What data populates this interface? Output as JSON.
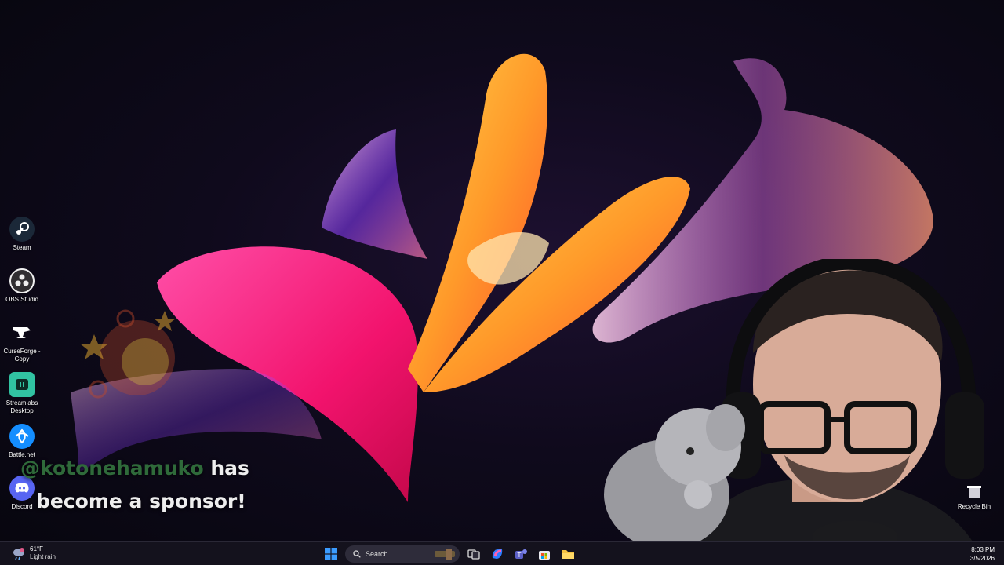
{
  "desktop": {
    "icons": [
      {
        "label": "Steam",
        "icon": "steam-icon"
      },
      {
        "label": "OBS Studio",
        "icon": "obs-icon"
      },
      {
        "label": "CurseForge - Copy",
        "icon": "curseforge-icon"
      },
      {
        "label": "Streamlabs Desktop",
        "icon": "streamlabs-icon"
      },
      {
        "label": "Battle.net",
        "icon": "battlenet-icon"
      },
      {
        "label": "Discord",
        "icon": "discord-icon"
      }
    ],
    "recycle_bin": {
      "label": "Recycle Bin",
      "icon": "recycle-bin-icon"
    }
  },
  "alert": {
    "username": "@kotonehamuko",
    "message_part1": " has",
    "message_part2": "become a sponsor!"
  },
  "taskbar": {
    "weather": {
      "temp": "61°F",
      "condition": "Light rain"
    },
    "search": {
      "placeholder": "Search"
    },
    "apps": [
      "windows-start-icon",
      "task-view-icon",
      "copilot-icon",
      "teams-icon",
      "store-icon",
      "file-explorer-icon"
    ],
    "clock": {
      "time": "8:03 PM",
      "date": "3/5/2026"
    }
  },
  "colors": {
    "background": "#0f0a1c",
    "taskbar": "#16141e",
    "alert_username": "#2f6a3a",
    "accent_windows": "#3b9cff"
  }
}
